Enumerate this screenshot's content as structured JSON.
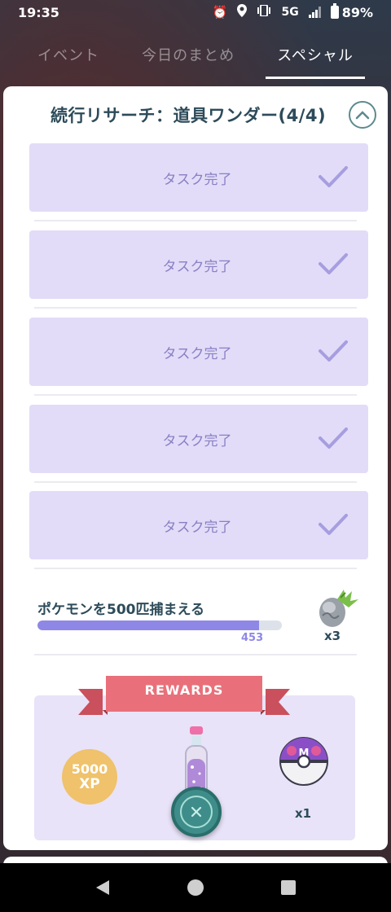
{
  "status_bar": {
    "time": "19:35",
    "network": "5G",
    "battery": "89%",
    "icons": [
      "alarm-icon",
      "location-icon",
      "vibrate-icon",
      "signal-icon",
      "battery-icon"
    ]
  },
  "tabs": [
    {
      "label": "イベント",
      "active": false
    },
    {
      "label": "今日のまとめ",
      "active": false
    },
    {
      "label": "スペシャル",
      "active": true
    }
  ],
  "research": {
    "title": "続行リサーチ：道具ワンダー(4/4)",
    "completed_tasks": [
      {
        "label": "タスク完了"
      },
      {
        "label": "タスク完了"
      },
      {
        "label": "タスク完了"
      },
      {
        "label": "タスク完了"
      },
      {
        "label": "タスク完了"
      }
    ],
    "current_task": {
      "label": "ポケモンを500匹捕まえる",
      "progress_value": "453",
      "progress_fraction": 0.906,
      "reward_count": "x3",
      "reward_icon": "metal-coat-stone-icon"
    },
    "rewards": {
      "banner_label": "REWARDS",
      "xp_amount": "5000",
      "xp_unit": "XP",
      "items": [
        {
          "icon": "glitter-potion-icon"
        },
        {
          "icon": "master-ball-icon",
          "count": "x1"
        }
      ]
    }
  },
  "colors": {
    "task_bg": "#e2dcf8",
    "task_text": "#8a80c4",
    "title_text": "#2d4b5a",
    "progress_fill": "#8e87e6",
    "banner": "#e9707a",
    "xp_badge": "#efc26b",
    "fab": "#3f8d8a"
  }
}
